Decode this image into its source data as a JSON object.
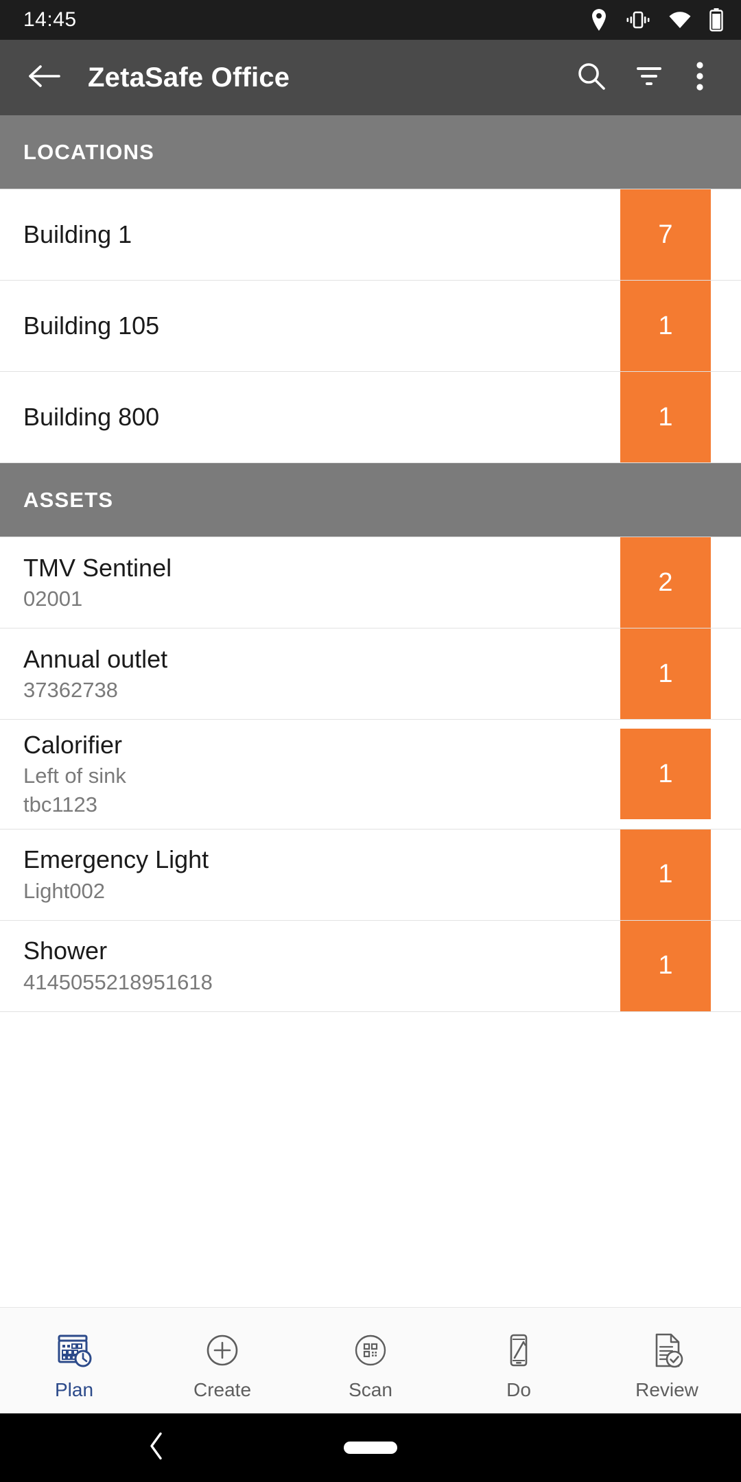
{
  "status_bar": {
    "time": "14:45",
    "icons": [
      "location-pin-icon",
      "vibrate-icon",
      "wifi-icon",
      "battery-icon"
    ]
  },
  "app_bar": {
    "title": "ZetaSafe Office",
    "back_icon": "arrow-back-icon",
    "actions": [
      {
        "name": "search-icon",
        "label": "Search"
      },
      {
        "name": "filter-icon",
        "label": "Filter"
      },
      {
        "name": "overflow-menu-icon",
        "label": "More options"
      }
    ]
  },
  "colors": {
    "badge_orange": "#f47b31",
    "section_grey": "#7b7b7b",
    "appbar_grey": "#4a4a4a",
    "status_black": "#1d1d1d",
    "active_nav_blue": "#2c4a8a"
  },
  "sections": [
    {
      "header": "LOCATIONS",
      "rows": [
        {
          "title": "Building 1",
          "subtitles": [],
          "badge": "7"
        },
        {
          "title": "Building 105",
          "subtitles": [],
          "badge": "1"
        },
        {
          "title": "Building 800",
          "subtitles": [],
          "badge": "1"
        }
      ]
    },
    {
      "header": "ASSETS",
      "rows": [
        {
          "title": "TMV Sentinel",
          "subtitles": [
            "02001"
          ],
          "badge": "2"
        },
        {
          "title": "Annual outlet",
          "subtitles": [
            "37362738"
          ],
          "badge": "1"
        },
        {
          "title": "Calorifier",
          "subtitles": [
            "Left of sink",
            "tbc1123"
          ],
          "badge": "1"
        },
        {
          "title": "Emergency Light",
          "subtitles": [
            "Light002"
          ],
          "badge": "1"
        },
        {
          "title": "Shower",
          "subtitles": [
            "4145055218951618"
          ],
          "badge": "1"
        }
      ]
    }
  ],
  "bottom_nav": {
    "items": [
      {
        "label": "Plan",
        "icon": "calendar-clock-icon",
        "active": true
      },
      {
        "label": "Create",
        "icon": "plus-circle-icon",
        "active": false
      },
      {
        "label": "Scan",
        "icon": "qr-code-icon",
        "active": false
      },
      {
        "label": "Do",
        "icon": "phone-pencil-icon",
        "active": false
      },
      {
        "label": "Review",
        "icon": "document-check-icon",
        "active": false
      }
    ]
  },
  "system_nav": {
    "back_icon": "system-back-icon",
    "home_icon": "system-home-pill"
  }
}
